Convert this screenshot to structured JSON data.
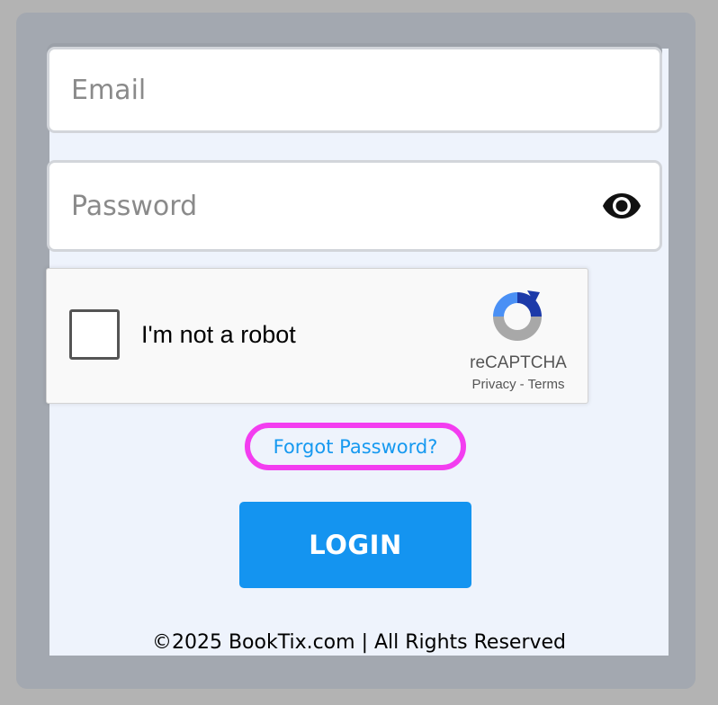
{
  "form": {
    "email": {
      "value": "",
      "placeholder": "Email"
    },
    "password": {
      "value": "",
      "placeholder": "Password",
      "toggle_icon": "eye-icon"
    },
    "captcha": {
      "label": "I'm not a robot",
      "checked": false,
      "brand": "reCAPTCHA",
      "privacy_link": "Privacy",
      "separator": "-",
      "terms_link": "Terms",
      "logo_icon": "recaptcha-logo-icon"
    },
    "forgot_password_label": "Forgot Password?",
    "login_label": "LOGIN"
  },
  "footer": {
    "copyright": "©2025 BookTix.com | All Rights Reserved"
  },
  "colors": {
    "page_background": "#b3b3b3",
    "frame": "#a3a8b0",
    "panel": "#eef3fc",
    "accent_blue": "#1494f0",
    "link_blue": "#1699f0",
    "highlight_magenta": "#f33df0"
  }
}
